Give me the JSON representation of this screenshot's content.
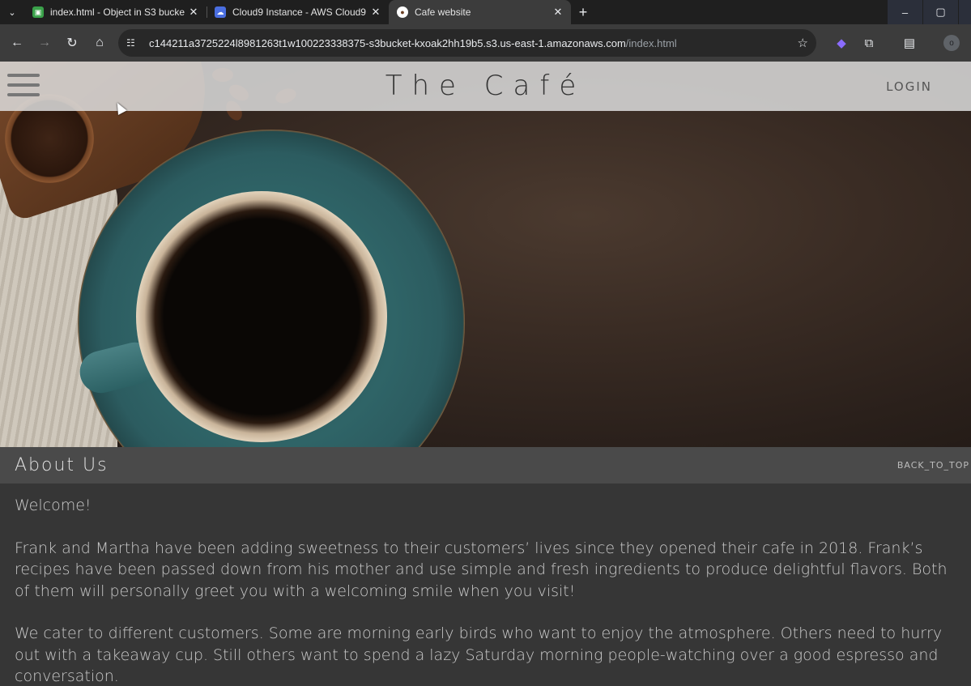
{
  "browser": {
    "tabs": [
      {
        "title": "index.html - Object in S3 bucke",
        "favicon": "s3-icon",
        "favicon_color": "#3aa14a",
        "active": false
      },
      {
        "title": "Cloud9 Instance - AWS Cloud9",
        "favicon": "cloud9-icon",
        "favicon_color": "#4a6ee0",
        "active": false
      },
      {
        "title": "Cafe website",
        "favicon": "coffee-cup-icon",
        "favicon_color": "#ffffff",
        "active": true
      }
    ],
    "url_host": "c144211a3725224l8981263t1w100223338375-s3bucket-kxoak2hh19b5.s3.us-east-1.amazonaws.com",
    "url_path": "/index.html",
    "profile_initial": "o"
  },
  "site": {
    "title": "The Café",
    "login_label": "LOGIN",
    "about_title": "About Us",
    "back_to_top_label": "BACK_TO_TOP",
    "paragraphs": [
      "Welcome!",
      "Frank and Martha have been adding sweetness to their customers’ lives since they opened their cafe in 2018. Frank’s recipes have been passed down from his mother and use simple and fresh ingredients to produce delightful flavors. Both of them will personally greet you with a welcoming smile when you visit!",
      "We cater to different customers. Some are morning early birds who want to enjoy the atmosphere. Others need to hurry out with a takeaway cup. Still others want to spend a lazy Saturday morning people-watching over a good espresso and conversation."
    ]
  }
}
